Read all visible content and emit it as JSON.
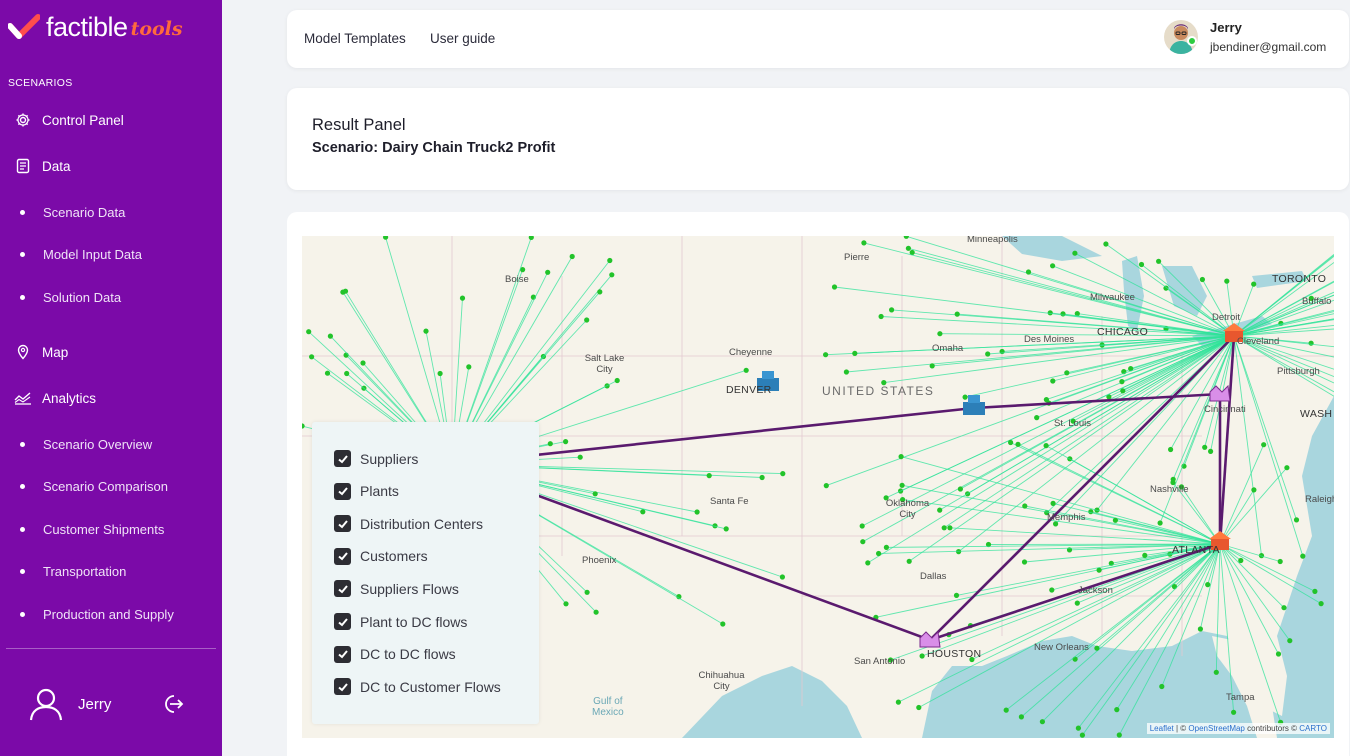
{
  "brand": {
    "name": "factible",
    "suffix": "tools",
    "accent": "#ff6a3d",
    "sidebar_bg": "#7b0aa8"
  },
  "sidebar": {
    "section_title": "SCENARIOS",
    "items": [
      {
        "label": "Control Panel",
        "icon": "gear-icon"
      },
      {
        "label": "Data",
        "icon": "document-icon"
      },
      {
        "label": "Scenario Data",
        "sub": true
      },
      {
        "label": "Model Input Data",
        "sub": true
      },
      {
        "label": "Solution Data",
        "sub": true
      },
      {
        "label": "Map",
        "icon": "map-pin-icon"
      },
      {
        "label": "Analytics",
        "icon": "chart-line-icon"
      },
      {
        "label": "Scenario Overview",
        "sub": true
      },
      {
        "label": "Scenario Comparison",
        "sub": true
      },
      {
        "label": "Customer Shipments",
        "sub": true
      },
      {
        "label": "Transportation",
        "sub": true
      },
      {
        "label": "Production and Supply",
        "sub": true
      }
    ],
    "user_name": "Jerry"
  },
  "topbar": {
    "links": [
      "Model Templates",
      "User guide"
    ],
    "user": {
      "name": "Jerry",
      "email": "jbendiner@gmail.com"
    }
  },
  "result": {
    "title": "Result Panel",
    "scenario": "Scenario: Dairy Chain Truck2 Profit"
  },
  "map": {
    "country": "UNITED STATES",
    "gulf": [
      "Gulf of",
      "Mexico"
    ],
    "cities": [
      "Minneapolis",
      "Pierre",
      "Boise",
      "TORONTO",
      "Buffalo",
      "Milwaukee",
      "Detroit",
      "CHICAGO",
      "Des Moines",
      "Cleveland",
      "Omaha",
      "Pittsburgh",
      "Cheyenne",
      "Salt Lake City",
      "DENVER",
      "Cincinnati",
      "WASH",
      "St. Louis",
      "Nashville",
      "Santa Fe",
      "Oklahoma City",
      "Memphis",
      "Raleigh",
      "Phoenix",
      "ATLANTA",
      "Dallas",
      "Jackson",
      "San Antonio",
      "HOUSTON",
      "New Orleans",
      "Chihuahua City",
      "Tampa"
    ],
    "attribution": {
      "leaflet": "Leaflet",
      "osm": "OpenStreetMap",
      "middle": "contributors ©",
      "carto": "CARTO"
    },
    "colors": {
      "customer": "#22c32a",
      "flow": "#2fe39a",
      "dc_flow": "#5a1a6e"
    }
  },
  "legend": {
    "items": [
      {
        "label": "Suppliers",
        "checked": true
      },
      {
        "label": "Plants",
        "checked": true
      },
      {
        "label": "Distribution Centers",
        "checked": true
      },
      {
        "label": "Customers",
        "checked": true
      },
      {
        "label": "Suppliers Flows",
        "checked": true
      },
      {
        "label": "Plant to DC flows",
        "checked": true
      },
      {
        "label": "DC to DC flows",
        "checked": true
      },
      {
        "label": "DC to Customer Flows",
        "checked": true
      }
    ]
  }
}
